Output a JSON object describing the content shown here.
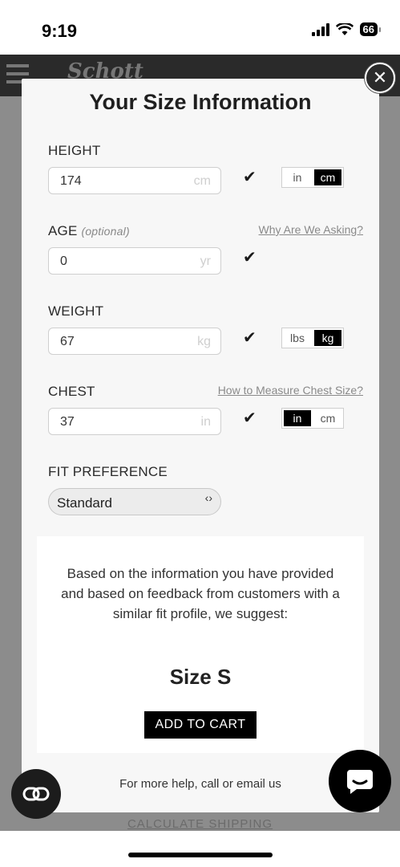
{
  "status_bar": {
    "time": "9:19",
    "battery": "66"
  },
  "background": {
    "logo": "Schott",
    "footer_link": "CALCULATE SHIPPING"
  },
  "modal": {
    "title": "Your Size Information",
    "height": {
      "label": "HEIGHT",
      "value": "174",
      "unit": "cm",
      "toggle": [
        "in",
        "cm"
      ],
      "active": "cm"
    },
    "age": {
      "label": "AGE",
      "optional": "(optional)",
      "help_link": "Why Are We Asking?",
      "value": "0",
      "unit": "yr"
    },
    "weight": {
      "label": "WEIGHT",
      "value": "67",
      "unit": "kg",
      "toggle": [
        "lbs",
        "kg"
      ],
      "active": "kg"
    },
    "chest": {
      "label": "CHEST",
      "help_link": "How to Measure Chest Size?",
      "value": "37",
      "unit": "in",
      "toggle": [
        "in",
        "cm"
      ],
      "active": "in"
    },
    "fit_preference": {
      "label": "FIT PREFERENCE",
      "value": "Standard"
    },
    "suggestion": {
      "text": "Based on the information you have provided and based on feedback from customers with a similar fit profile, we suggest:",
      "size": "Size S",
      "add_to_cart": "ADD TO CART"
    },
    "help_text": "For more help, call or email us"
  }
}
